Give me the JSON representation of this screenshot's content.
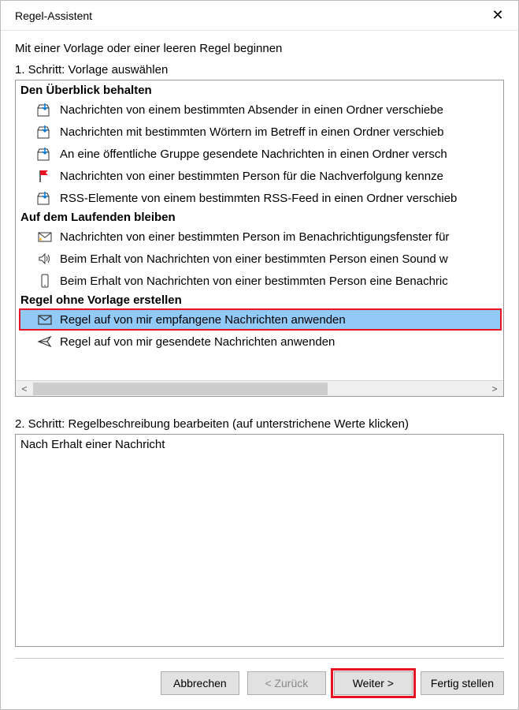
{
  "window": {
    "title": "Regel-Assistent"
  },
  "intro": "Mit einer Vorlage oder einer leeren Regel beginnen",
  "step1": {
    "label": "1. Schritt: Vorlage auswählen",
    "sections": [
      {
        "header": "Den Überblick behalten",
        "items": [
          {
            "icon": "folder-arrow",
            "label": "Nachrichten von einem bestimmten Absender in einen Ordner verschiebe"
          },
          {
            "icon": "folder-arrow",
            "label": "Nachrichten mit bestimmten Wörtern im Betreff in einen Ordner verschieb"
          },
          {
            "icon": "folder-arrow",
            "label": "An eine öffentliche Gruppe gesendete Nachrichten in einen Ordner versch"
          },
          {
            "icon": "flag",
            "label": "Nachrichten von einer bestimmten Person für die Nachverfolgung kennze"
          },
          {
            "icon": "folder-arrow",
            "label": "RSS-Elemente von einem bestimmten RSS-Feed in einen Ordner verschieb"
          }
        ]
      },
      {
        "header": "Auf dem Laufenden bleiben",
        "items": [
          {
            "icon": "envelope-star",
            "label": "Nachrichten von einer bestimmten Person im Benachrichtigungsfenster für"
          },
          {
            "icon": "speaker",
            "label": "Beim Erhalt von Nachrichten von einer bestimmten Person einen Sound w"
          },
          {
            "icon": "phone",
            "label": "Beim Erhalt von Nachrichten von einer bestimmten Person eine Benachric"
          }
        ]
      },
      {
        "header": "Regel ohne Vorlage erstellen",
        "items": [
          {
            "icon": "envelope",
            "label": "Regel auf von mir empfangene Nachrichten anwenden",
            "selected": true
          },
          {
            "icon": "send",
            "label": "Regel auf von mir gesendete Nachrichten anwenden"
          }
        ]
      }
    ]
  },
  "step2": {
    "label": "2. Schritt: Regelbeschreibung bearbeiten (auf unterstrichene Werte klicken)",
    "description": "Nach Erhalt einer Nachricht"
  },
  "buttons": {
    "cancel": "Abbrechen",
    "back": "< Zurück",
    "next": "Weiter >",
    "finish": "Fertig stellen"
  }
}
